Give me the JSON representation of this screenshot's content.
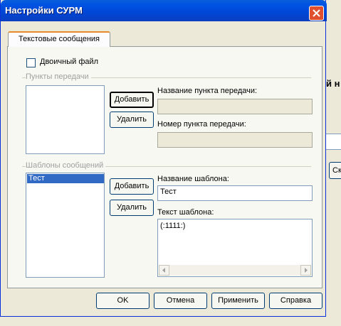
{
  "window": {
    "title": "Настройки СУРМ",
    "close_label": "✕"
  },
  "tab": {
    "label": "Текстовые сообщения"
  },
  "binary_file": {
    "label": "Двоичный файл",
    "checked": false
  },
  "transmission_points": {
    "group_label": "Пункты передачи",
    "items": [],
    "add_label": "Добавить",
    "remove_label": "Удалить",
    "name_label": "Название пункта передачи:",
    "name_value": "",
    "number_label": "Номер пункта передачи:",
    "number_value": ""
  },
  "message_templates": {
    "group_label": "Шаблоны сообщений",
    "items": [
      "Тест"
    ],
    "selected": "Тест",
    "add_label": "Добавить",
    "remove_label": "Удалить",
    "template_name_label": "Название шаблона:",
    "template_name_value": "Тест",
    "template_text_label": "Текст шаблона:",
    "template_text_value": "(:1111:)"
  },
  "footer": {
    "ok_label": "OK",
    "cancel_label": "Отмена",
    "apply_label": "Применить",
    "help_label": "Справка"
  },
  "background_window": {
    "fragment_text": "й н",
    "button_fragment": "Ск"
  },
  "colors": {
    "titlebar": "#0054e3",
    "selection": "#316ac5",
    "tab_accent": "#e68b2c",
    "close_button": "#e0502f"
  }
}
